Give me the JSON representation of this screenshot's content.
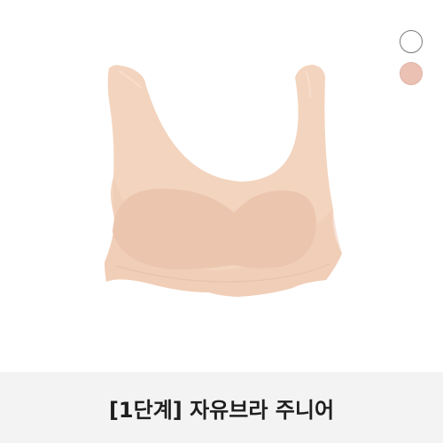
{
  "product": {
    "title": "[1단계] 자유브라 주니어",
    "image_icon": "bra-product-image",
    "product_color": "#f3d4be"
  },
  "color_options": [
    {
      "icon": "white-color-swatch",
      "fill": "#ffffff",
      "border": "#7a7a7a"
    },
    {
      "icon": "beige-color-swatch",
      "fill": "#ebc1b4",
      "border": "#e0b3a4"
    }
  ],
  "colors": {
    "caption_background": "#f3f3f3",
    "title_text": "#1f1f1f"
  }
}
